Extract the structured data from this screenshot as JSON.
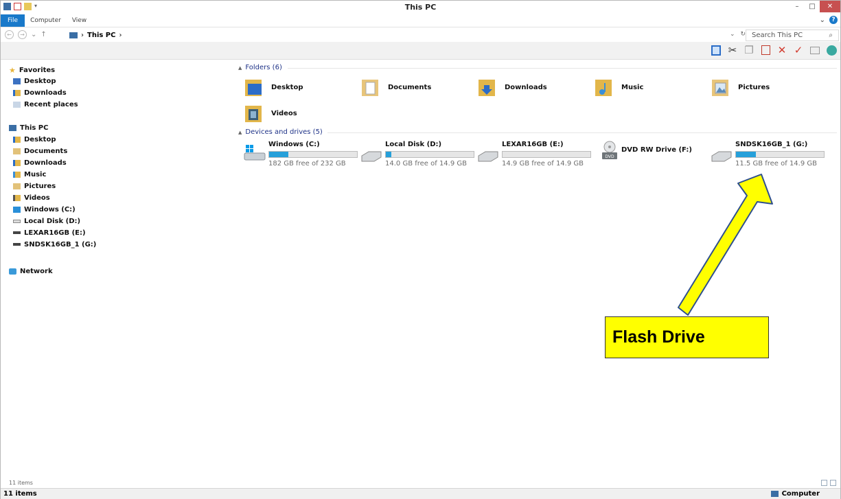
{
  "window": {
    "title": "This PC"
  },
  "ribbon": {
    "tabs": [
      "File",
      "Computer",
      "View"
    ]
  },
  "address": {
    "path_root": "This PC",
    "separator": "›",
    "search_placeholder": "Search This PC"
  },
  "nav": {
    "favorites": {
      "label": "Favorites",
      "items": [
        "Desktop",
        "Downloads",
        "Recent places"
      ]
    },
    "this_pc": {
      "label": "This PC",
      "items": [
        "Desktop",
        "Documents",
        "Downloads",
        "Music",
        "Pictures",
        "Videos",
        "Windows (C:)",
        "Local Disk (D:)",
        "LEXAR16GB (E:)",
        "SNDSK16GB_1 (G:)"
      ]
    },
    "network": {
      "label": "Network"
    }
  },
  "folders": {
    "header": "Folders (6)",
    "items": [
      "Desktop",
      "Documents",
      "Downloads",
      "Music",
      "Pictures",
      "Videos"
    ]
  },
  "drives": {
    "header": "Devices and drives (5)",
    "items": [
      {
        "name": "Windows (C:)",
        "free": "182 GB free of 232 GB",
        "used_fraction": 0.22
      },
      {
        "name": "Local Disk (D:)",
        "free": "14.0 GB free of 14.9 GB",
        "used_fraction": 0.06
      },
      {
        "name": "LEXAR16GB (E:)",
        "free": "14.9 GB free of 14.9 GB",
        "used_fraction": 0.0
      },
      {
        "name": "DVD RW Drive (F:)",
        "free": "",
        "used_fraction": null
      },
      {
        "name": "SNDSK16GB_1 (G:)",
        "free": "11.5 GB free of 14.9 GB",
        "used_fraction": 0.23
      }
    ]
  },
  "status": {
    "inner": "11 items",
    "bottom": "11 items",
    "computer": "Computer"
  },
  "annotation": {
    "label": "Flash Drive",
    "color": "#ffff00"
  },
  "colors": {
    "accent": "#1979ca",
    "drive_bar": "#26a0da",
    "group_header": "#1e3287"
  }
}
